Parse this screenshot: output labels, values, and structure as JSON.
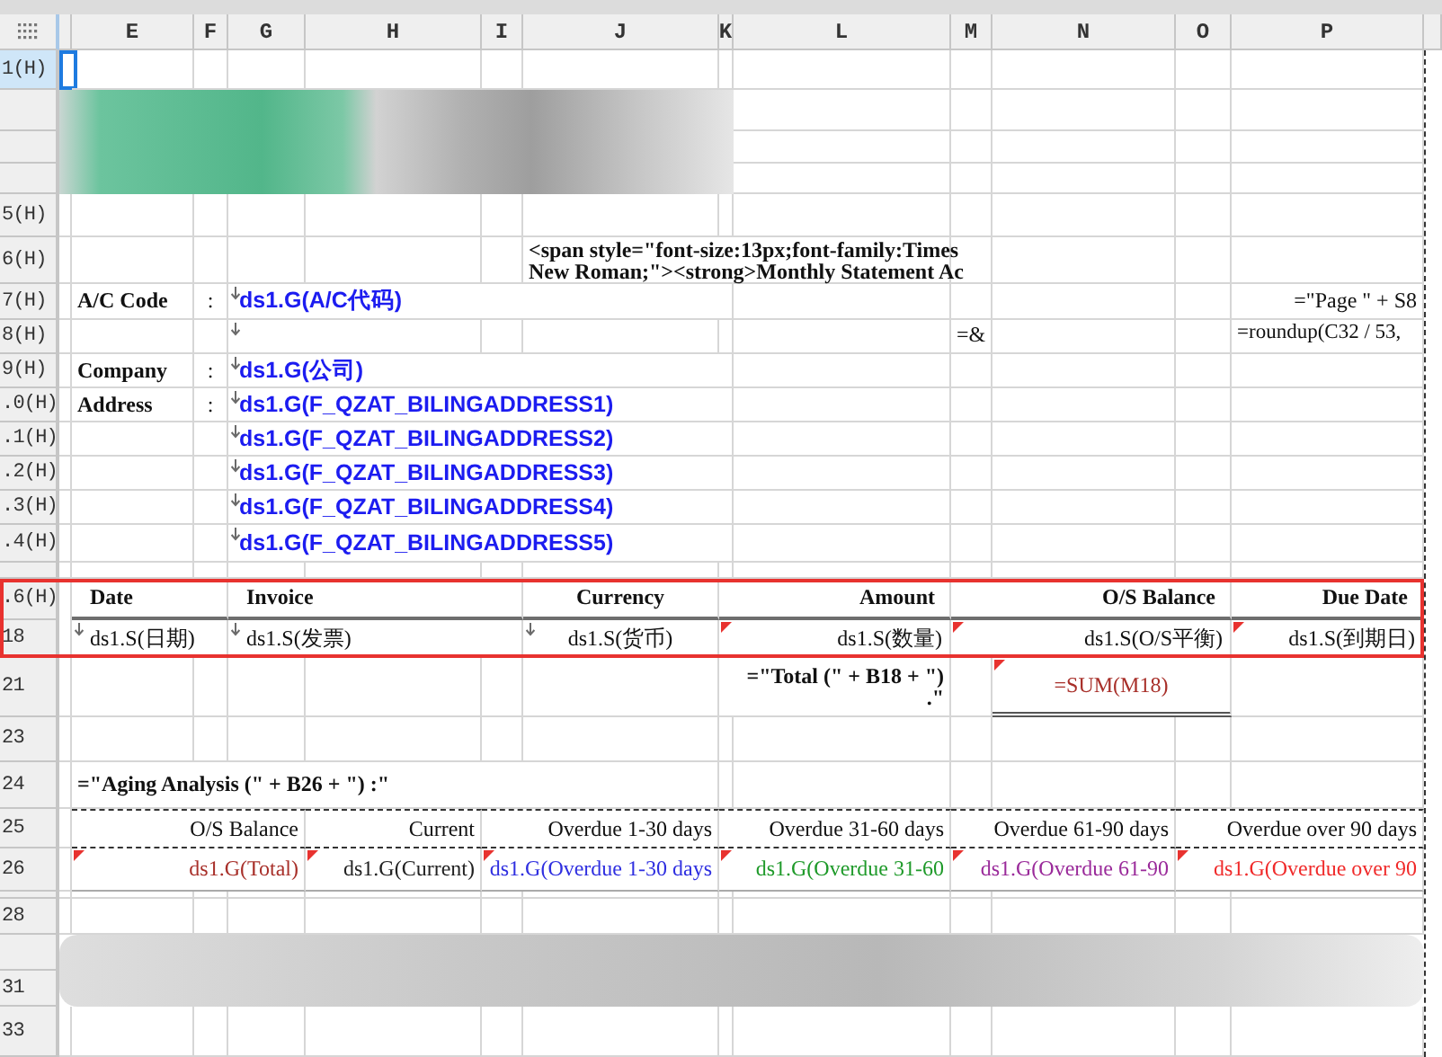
{
  "column_headers": [
    "E",
    "F",
    "G",
    "H",
    "I",
    "J",
    "K",
    "L",
    "M",
    "N",
    "O",
    "P"
  ],
  "row_headers": [
    {
      "label": "1(H)",
      "selected": true
    },
    {
      "label": "5(H)",
      "selected": false
    },
    {
      "label": "6(H)",
      "selected": false
    },
    {
      "label": "7(H)",
      "selected": false
    },
    {
      "label": "8(H)",
      "selected": false
    },
    {
      "label": "9(H)",
      "selected": false
    },
    {
      "label": ".0(H)",
      "selected": false
    },
    {
      "label": ".1(H)",
      "selected": false
    },
    {
      "label": ".2(H)",
      "selected": false
    },
    {
      "label": ".3(H)",
      "selected": false
    },
    {
      "label": ".4(H)",
      "selected": false
    },
    {
      "label": ".6(H)",
      "selected": false
    },
    {
      "label": "18",
      "selected": false
    },
    {
      "label": "21",
      "selected": false
    },
    {
      "label": "23",
      "selected": false
    },
    {
      "label": "24",
      "selected": false
    },
    {
      "label": "25",
      "selected": false
    },
    {
      "label": "26",
      "selected": false
    },
    {
      "label": "28",
      "selected": false
    },
    {
      "label": "31",
      "selected": false
    },
    {
      "label": "33",
      "selected": false
    }
  ],
  "template_code": [
    "<span style=\"font-size:13px;font-family:Times",
    "New Roman;\"><strong>Monthly Statement Ac"
  ],
  "account_fields": [
    {
      "label": "A/C Code",
      "separator": ":",
      "value": "ds1.G(A/C代码)"
    },
    {
      "label": "Company",
      "separator": ":",
      "value": "ds1.G(公司)"
    },
    {
      "label": "Address",
      "separator": ":",
      "value": "ds1.G(F_QZAT_BILINGADDRESS1)"
    }
  ],
  "address_lines": [
    "ds1.G(F_QZAT_BILINGADDRESS2)",
    "ds1.G(F_QZAT_BILINGADDRESS3)",
    "ds1.G(F_QZAT_BILINGADDRESS4)",
    "ds1.G(F_QZAT_BILINGADDRESS5)"
  ],
  "page_formula": "=\"Page \" + S8",
  "formula_fragment": "=&",
  "page_count_formula": "=roundup(C32 / 53,",
  "statement_table": {
    "columns": [
      "Date",
      "Invoice",
      "Currency",
      "Amount",
      "O/S Balance",
      "Due Date"
    ],
    "row": [
      "ds1.S(日期)",
      "ds1.S(发票)",
      "ds1.S(货币)",
      "ds1.S(数量)",
      "ds1.S(O/S平衡)",
      "ds1.S(到期日)"
    ]
  },
  "total": {
    "label_lines": [
      "=\"Total (\" + B18 + \")",
      ".\""
    ],
    "sum": "=SUM(M18)"
  },
  "aging": {
    "title": "=\"Aging Analysis (\" + B26 + \") :\"",
    "columns": [
      {
        "label": "O/S Balance",
        "value": "ds1.G(Total)",
        "color": "#a8302a"
      },
      {
        "label": "Current",
        "value": "ds1.G(Current)",
        "color": "#222222"
      },
      {
        "label": "Overdue 1-30 days",
        "value": "ds1.G(Overdue 1-30 days",
        "color": "#2f2fe0"
      },
      {
        "label": "Overdue 31-60 days",
        "value": "ds1.G(Overdue 31-60",
        "color": "#1f9a2a"
      },
      {
        "label": "Overdue 61-90 days",
        "value": "ds1.G(Overdue 61-90",
        "color": "#9a2a9a"
      },
      {
        "label": "Overdue over 90 days",
        "value": "ds1.G(Overdue over 90",
        "color": "#f02a2a"
      }
    ]
  }
}
